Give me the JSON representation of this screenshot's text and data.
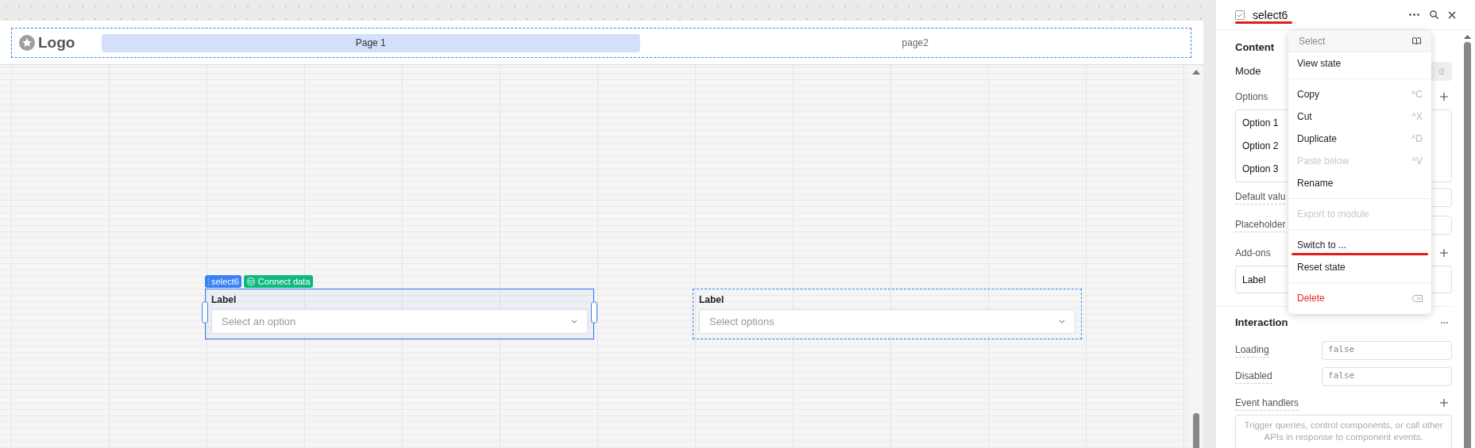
{
  "header": {
    "logo": "Logo",
    "pages": [
      {
        "label": "Page 1",
        "selected": true
      },
      {
        "label": "page2",
        "selected": false
      }
    ]
  },
  "canvas": {
    "components": [
      {
        "name_tag": "select6",
        "connect_tag": "Connect data",
        "label": "Label",
        "placeholder": "Select an option",
        "selected": true
      },
      {
        "label": "Label",
        "placeholder": "Select options",
        "selected": false
      }
    ]
  },
  "inspector": {
    "title": "select6",
    "title_underlined": true,
    "content": {
      "heading": "Content",
      "mode_label": "Mode",
      "mode_value": "d",
      "options_label": "Options",
      "options": [
        "Option 1",
        "Option 2",
        "Option 3"
      ],
      "default_value_label": "Default valu",
      "placeholder_label": "Placeholder",
      "addons_label": "Add-ons",
      "addons": [
        "Label"
      ]
    },
    "interaction": {
      "heading": "Interaction",
      "fields": [
        {
          "label": "Loading",
          "value": "false"
        },
        {
          "label": "Disabled",
          "value": "false"
        }
      ],
      "event_handlers_label": "Event handlers",
      "event_handlers_hint": "Trigger queries, control components, or call other APIs in response to component events."
    }
  },
  "context_menu": {
    "items": [
      {
        "kind": "header",
        "label": "Select"
      },
      {
        "kind": "item",
        "label": "View state",
        "disabled": false,
        "underlined": false
      },
      {
        "kind": "divider"
      },
      {
        "kind": "item",
        "label": "Copy",
        "shortcut": "^C",
        "disabled": false,
        "underlined": false
      },
      {
        "kind": "item",
        "label": "Cut",
        "shortcut": "^X",
        "disabled": false,
        "underlined": false
      },
      {
        "kind": "item",
        "label": "Duplicate",
        "shortcut": "^D",
        "disabled": false,
        "underlined": false
      },
      {
        "kind": "item",
        "label": "Paste below",
        "shortcut": "^V",
        "disabled": true,
        "underlined": false
      },
      {
        "kind": "item",
        "label": "Rename",
        "disabled": false,
        "underlined": false
      },
      {
        "kind": "divider"
      },
      {
        "kind": "item",
        "label": "Export to module",
        "disabled": true,
        "underlined": false
      },
      {
        "kind": "divider"
      },
      {
        "kind": "item",
        "label": "Switch to ...",
        "disabled": false,
        "underlined": true
      },
      {
        "kind": "item",
        "label": "Reset state",
        "disabled": false,
        "underlined": false
      },
      {
        "kind": "divider"
      },
      {
        "kind": "danger",
        "label": "Delete"
      }
    ]
  }
}
